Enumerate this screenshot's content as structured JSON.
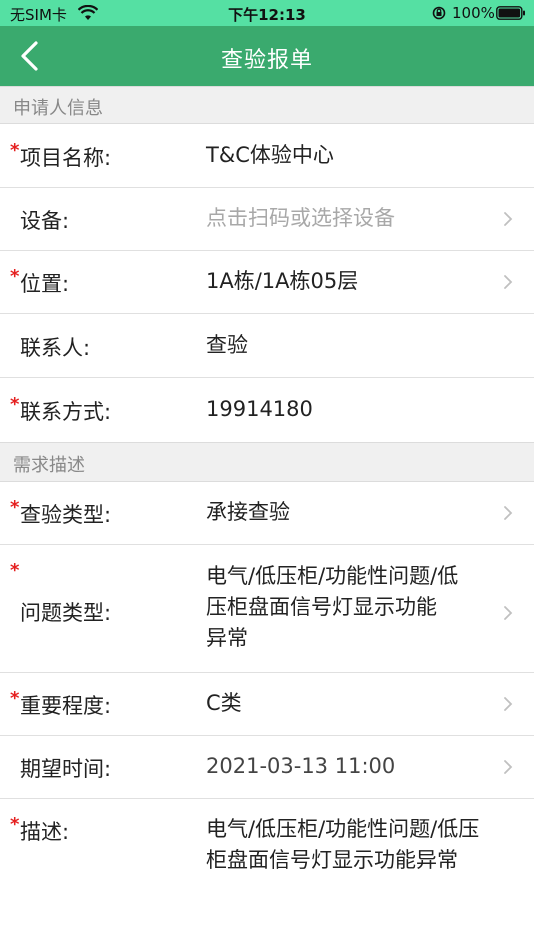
{
  "status_bar": {
    "carrier": "无SIM卡",
    "time": "下午12:13",
    "battery_percent": "100%"
  },
  "nav": {
    "title": "查验报单"
  },
  "sections": {
    "applicant": "申请人信息",
    "requirement": "需求描述"
  },
  "fields": {
    "project_name": {
      "label": "项目名称:",
      "value": "T&C体验中心"
    },
    "device": {
      "label": "设备:",
      "placeholder": "点击扫码或选择设备"
    },
    "location": {
      "label": "位置:",
      "value": "1A栋/1A栋05层"
    },
    "contact": {
      "label": "联系人:",
      "value": "查验"
    },
    "contact_method": {
      "label": "联系方式:",
      "value": "19914180"
    },
    "inspection_type": {
      "label": "查验类型:",
      "value": "承接查验"
    },
    "problem_type": {
      "label": "问题类型:",
      "value_line1": "电气/低压柜/功能性问题/低",
      "value_line2": "压柜盘面信号灯显示功能",
      "value_line3": "异常"
    },
    "importance": {
      "label": "重要程度:",
      "value": "C类"
    },
    "expected_time": {
      "label": "期望时间:",
      "value": "2021-03-13 11:00"
    },
    "description": {
      "label": "描述:",
      "value_line1": "电气/低压柜/功能性问题/低压",
      "value_line2": "柜盘面信号灯显示功能异常"
    }
  },
  "required_mark": "*"
}
